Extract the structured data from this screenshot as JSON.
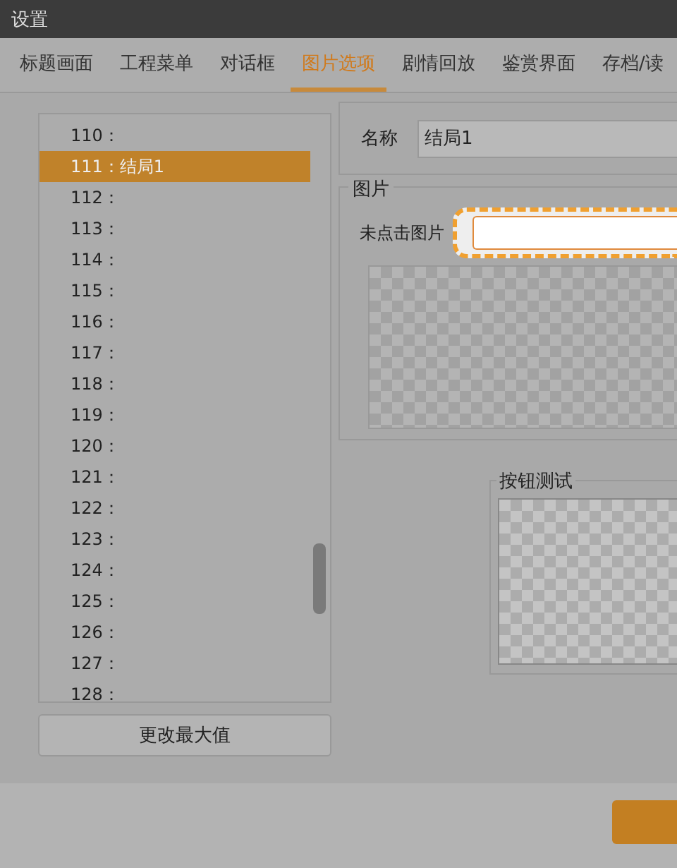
{
  "window": {
    "title": "设置"
  },
  "tabs": [
    {
      "label": "标题画面",
      "selected": false
    },
    {
      "label": "工程菜单",
      "selected": false
    },
    {
      "label": "对话框",
      "selected": false
    },
    {
      "label": "图片选项",
      "selected": true
    },
    {
      "label": "剧情回放",
      "selected": false
    },
    {
      "label": "鉴赏界面",
      "selected": false
    },
    {
      "label": "存档/读",
      "selected": false
    }
  ],
  "list": {
    "items": [
      {
        "label": "110：",
        "selected": false
      },
      {
        "label": "111：结局1",
        "selected": true
      },
      {
        "label": "112：",
        "selected": false
      },
      {
        "label": "113：",
        "selected": false
      },
      {
        "label": "114：",
        "selected": false
      },
      {
        "label": "115：",
        "selected": false
      },
      {
        "label": "116：",
        "selected": false
      },
      {
        "label": "117：",
        "selected": false
      },
      {
        "label": "118：",
        "selected": false
      },
      {
        "label": "119：",
        "selected": false
      },
      {
        "label": "120：",
        "selected": false
      },
      {
        "label": "121：",
        "selected": false
      },
      {
        "label": "122：",
        "selected": false
      },
      {
        "label": "123：",
        "selected": false
      },
      {
        "label": "124：",
        "selected": false
      },
      {
        "label": "125：",
        "selected": false
      },
      {
        "label": "126：",
        "selected": false
      },
      {
        "label": "127：",
        "selected": false
      },
      {
        "label": "128：",
        "selected": false
      }
    ],
    "button": "更改最大值"
  },
  "name_group": {
    "label": "名称",
    "value": "结局1"
  },
  "image_group": {
    "title": "图片",
    "field_label": "未点击图片"
  },
  "button_test": {
    "title": "按钮测试"
  }
}
